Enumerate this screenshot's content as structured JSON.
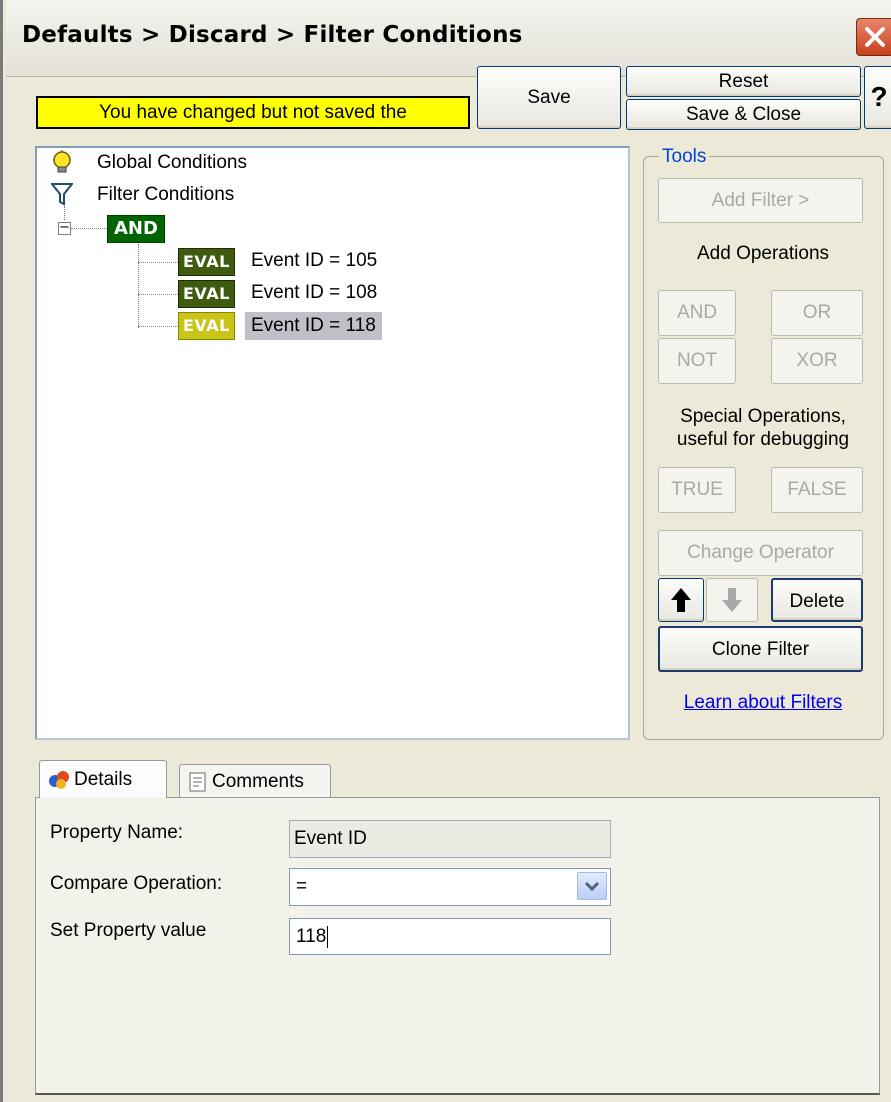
{
  "window": {
    "title": "Defaults > Discard > Filter Conditions"
  },
  "toolbar": {
    "warning": "You have changed but not saved the",
    "save_label": "Save",
    "reset_label": "Reset",
    "save_close_label": "Save & Close",
    "help_label": "?"
  },
  "tree": {
    "global_conditions": "Global Conditions",
    "filter_conditions": "Filter Conditions",
    "operator": "AND",
    "expander": "−",
    "items": [
      {
        "badge": "EVAL",
        "label": "Event ID = 105",
        "selected": false
      },
      {
        "badge": "EVAL",
        "label": "Event ID = 108",
        "selected": false
      },
      {
        "badge": "EVAL",
        "label": "Event ID = 118",
        "selected": true
      }
    ]
  },
  "tools": {
    "legend": "Tools",
    "add_filter": "Add Filter >",
    "add_operations": "Add Operations",
    "and": "AND",
    "or": "OR",
    "not": "NOT",
    "xor": "XOR",
    "special_ops_line1": "Special Operations,",
    "special_ops_line2": "useful for debugging",
    "true": "TRUE",
    "false": "FALSE",
    "change_operator": "Change Operator",
    "delete": "Delete",
    "clone_filter": "Clone Filter",
    "learn_link": "Learn about Filters"
  },
  "tabs": {
    "details": "Details",
    "comments": "Comments"
  },
  "details": {
    "property_name_label": "Property Name:",
    "property_name_value": "Event ID",
    "compare_label": "Compare Operation:",
    "compare_value": "=",
    "set_value_label": "Set Property value",
    "set_value": "118"
  },
  "colors": {
    "warning_bg": "#ffff00",
    "and_badge": "#006400",
    "eval_badge": "#3f5b0f",
    "eval_selected": "#c9c418",
    "link": "#0000ee",
    "close": "#d5532f"
  }
}
